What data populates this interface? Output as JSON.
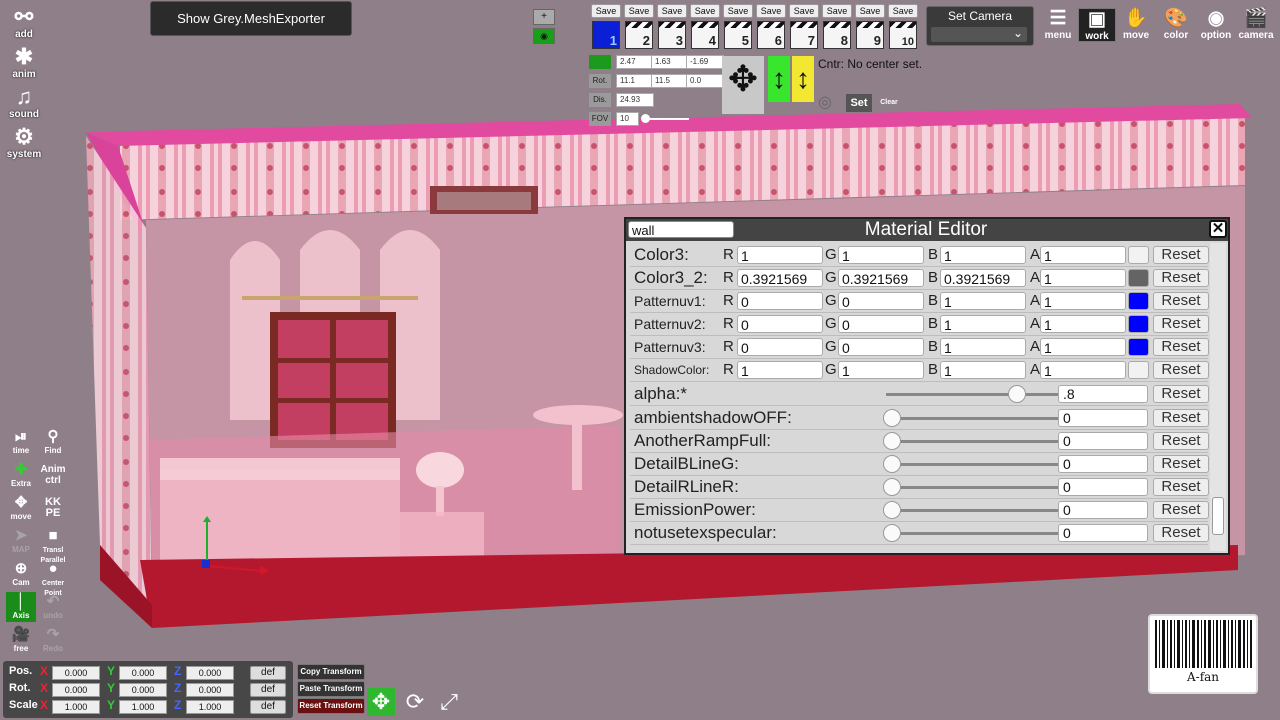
{
  "top": {
    "mesh_exporter_button": "Show Grey.MeshExporter",
    "save_label": "Save",
    "save_slots": [
      "1",
      "2",
      "3",
      "4",
      "5",
      "6",
      "7",
      "8",
      "9",
      "10"
    ],
    "active_slot": "1",
    "set_camera_label": "Set Camera",
    "right_tools": [
      {
        "label": "menu",
        "icon": "menu-icon"
      },
      {
        "label": "work",
        "icon": "work-icon"
      },
      {
        "label": "move",
        "icon": "hand-icon"
      },
      {
        "label": "color",
        "icon": "palette-icon"
      },
      {
        "label": "option",
        "icon": "eye-icon"
      },
      {
        "label": "camera",
        "icon": "clapper-icon"
      }
    ]
  },
  "camera_panel": {
    "rows": [
      {
        "label": "",
        "values": [
          "2.47",
          "1.63",
          "-1.69"
        ]
      },
      {
        "label": "Rot.",
        "values": [
          "11.1",
          "11.5",
          "0.0"
        ]
      },
      {
        "label": "Dis.",
        "values": [
          "24.93"
        ]
      },
      {
        "label": "FOV",
        "values": [
          "10"
        ]
      }
    ],
    "center_text": "Cntr: No center set.",
    "set_label": "Set",
    "clear_label": "Clear"
  },
  "left_toolbar": {
    "main": [
      {
        "label": "add",
        "icon": "add-user-icon"
      },
      {
        "label": "anim",
        "icon": "running-icon"
      },
      {
        "label": "sound",
        "icon": "music-icon"
      },
      {
        "label": "system",
        "icon": "gears-icon"
      }
    ],
    "small": [
      {
        "label": "time",
        "icon": "play-pause-icon"
      },
      {
        "label": "Find",
        "icon": "magnifier-icon"
      },
      {
        "label": "Extra",
        "icon": "axis-icon"
      },
      {
        "label": "Anim ctrl",
        "icon": ""
      },
      {
        "label": "move",
        "icon": "move-icon"
      },
      {
        "label": "KK PE",
        "icon": ""
      },
      {
        "label": "MAP",
        "icon": "arrow-icon"
      },
      {
        "label": "Transl Parallel",
        "icon": "square-icon"
      },
      {
        "label": "Cam",
        "icon": "plus-circle-icon"
      },
      {
        "label": "Center Point",
        "icon": "dot-icon"
      },
      {
        "label": "Axis",
        "icon": "axis-icon"
      },
      {
        "label": "undo",
        "icon": "undo-icon"
      },
      {
        "label": "free",
        "icon": "camera-icon"
      },
      {
        "label": "Redo",
        "icon": "redo-icon"
      }
    ]
  },
  "material_editor": {
    "title": "Material Editor",
    "search_value": "wall",
    "reset_label": "Reset",
    "color_rows": [
      {
        "name": "Color3:",
        "r": "1",
        "g": "1",
        "b": "1",
        "a": "1",
        "swatch": "#f2f2f2"
      },
      {
        "name": "Color3_2:",
        "r": "0.3921569",
        "g": "0.3921569",
        "b": "0.3921569",
        "a": "1",
        "swatch": "#646464"
      },
      {
        "name": "Patternuv1:",
        "r": "0",
        "g": "0",
        "b": "1",
        "a": "1",
        "swatch": "#0000ff"
      },
      {
        "name": "Patternuv2:",
        "r": "0",
        "g": "0",
        "b": "1",
        "a": "1",
        "swatch": "#0000ff"
      },
      {
        "name": "Patternuv3:",
        "r": "0",
        "g": "0",
        "b": "1",
        "a": "1",
        "swatch": "#0000ff"
      },
      {
        "name": "ShadowColor:",
        "r": "1",
        "g": "1",
        "b": "1",
        "a": "1",
        "swatch": "#f2f2f2"
      }
    ],
    "float_rows": [
      {
        "name": "alpha:*",
        "value": ".8",
        "level": 0.8
      },
      {
        "name": "ambientshadowOFF:",
        "value": "0",
        "level": 0
      },
      {
        "name": "AnotherRampFull:",
        "value": "0",
        "level": 0
      },
      {
        "name": "DetailBLineG:",
        "value": "0",
        "level": 0
      },
      {
        "name": "DetailRLineR:",
        "value": "0",
        "level": 0
      },
      {
        "name": "EmissionPower:",
        "value": "0",
        "level": 0
      },
      {
        "name": "notusetexspecular:",
        "value": "0",
        "level": 0
      }
    ]
  },
  "transform": {
    "rows": [
      {
        "label": "Pos.",
        "x": "0.000",
        "y": "0.000",
        "z": "0.000"
      },
      {
        "label": "Rot.",
        "x": "0.000",
        "y": "0.000",
        "z": "0.000"
      },
      {
        "label": "Scale",
        "x": "1.000",
        "y": "1.000",
        "z": "1.000"
      }
    ],
    "def_label": "def",
    "copy_label": "Copy Transform",
    "paste_label": "Paste Transform",
    "reset_label": "Reset Transform"
  },
  "badge": {
    "text": "A-fan"
  }
}
